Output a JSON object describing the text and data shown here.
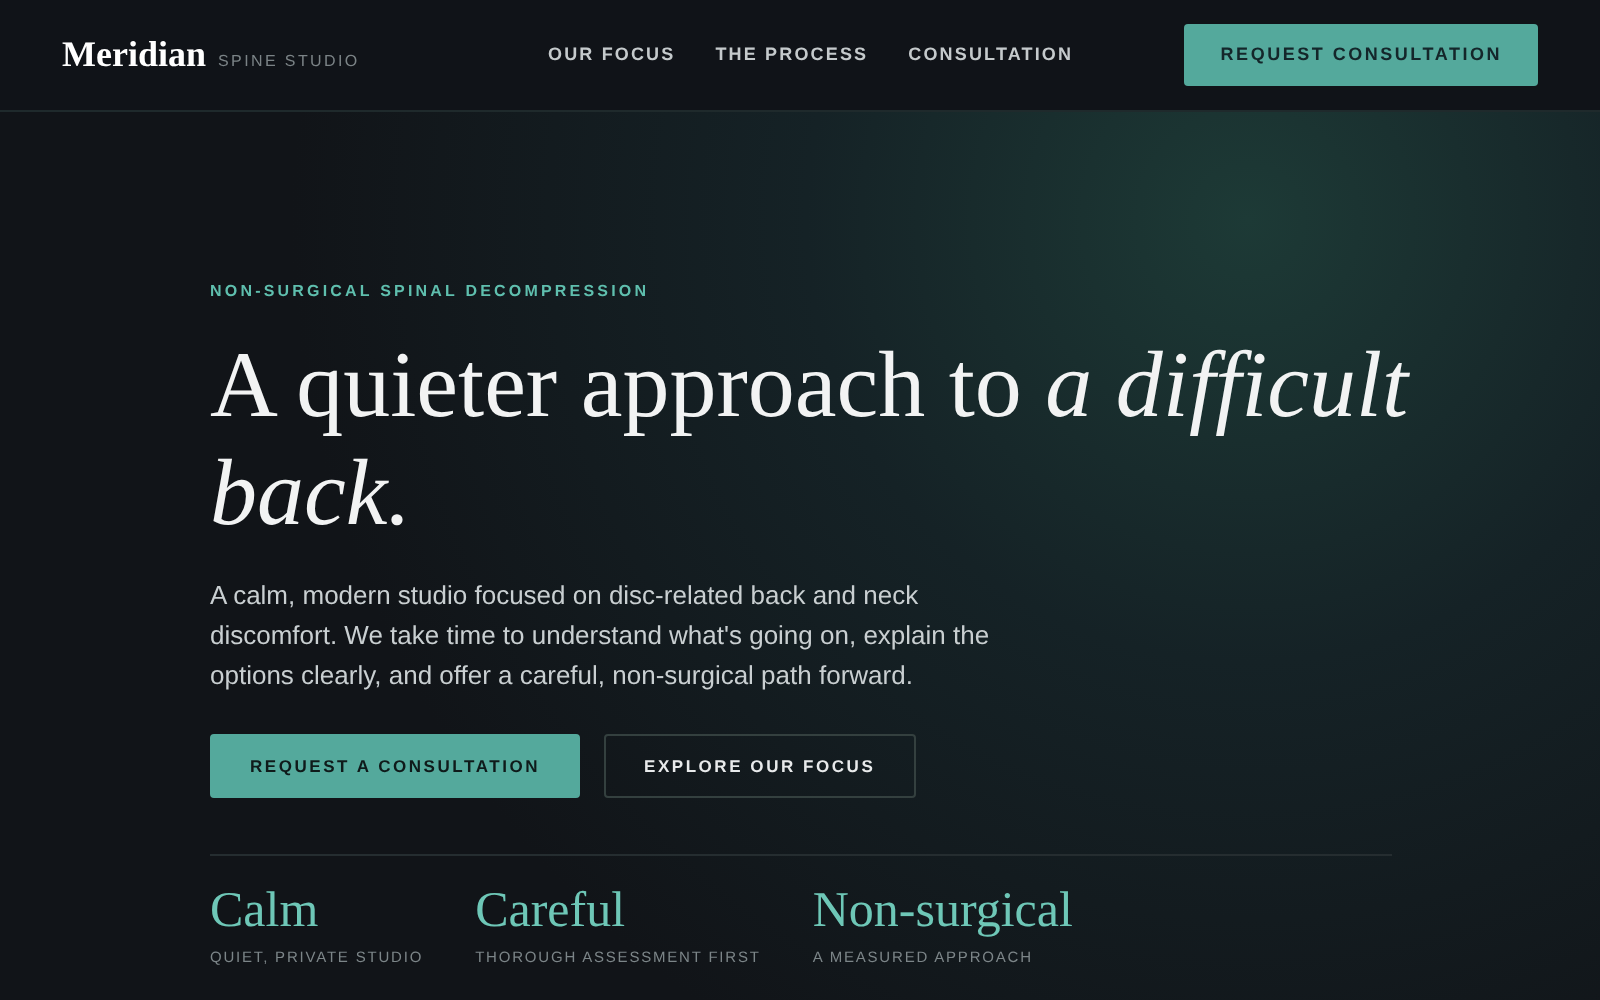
{
  "header": {
    "brand": "Meridian",
    "brand_sub": "SPINE STUDIO",
    "nav": [
      "OUR FOCUS",
      "THE PROCESS",
      "CONSULTATION"
    ],
    "cta": "REQUEST CONSULTATION"
  },
  "hero": {
    "eyebrow": "NON-SURGICAL SPINAL DECOMPRESSION",
    "heading": "A quieter approach to *a difficult back.*",
    "body": "A calm, modern studio focused on disc-related back and neck discomfort. We take time to understand what's going on, explain the options clearly, and offer a careful, non-surgical path forward.",
    "buttons": [
      {
        "label": "REQUEST A CONSULTATION",
        "kind": "primary"
      },
      {
        "label": "EXPLORE OUR FOCUS",
        "kind": "outline"
      }
    ]
  },
  "stats": [
    {
      "title": "Calm",
      "caption": "QUIET, PRIVATE STUDIO"
    },
    {
      "title": "Careful",
      "caption": "THOROUGH ASSESSMENT FIRST"
    },
    {
      "title": "Non-surgical",
      "caption": "A MEASURED APPROACH"
    }
  ]
}
